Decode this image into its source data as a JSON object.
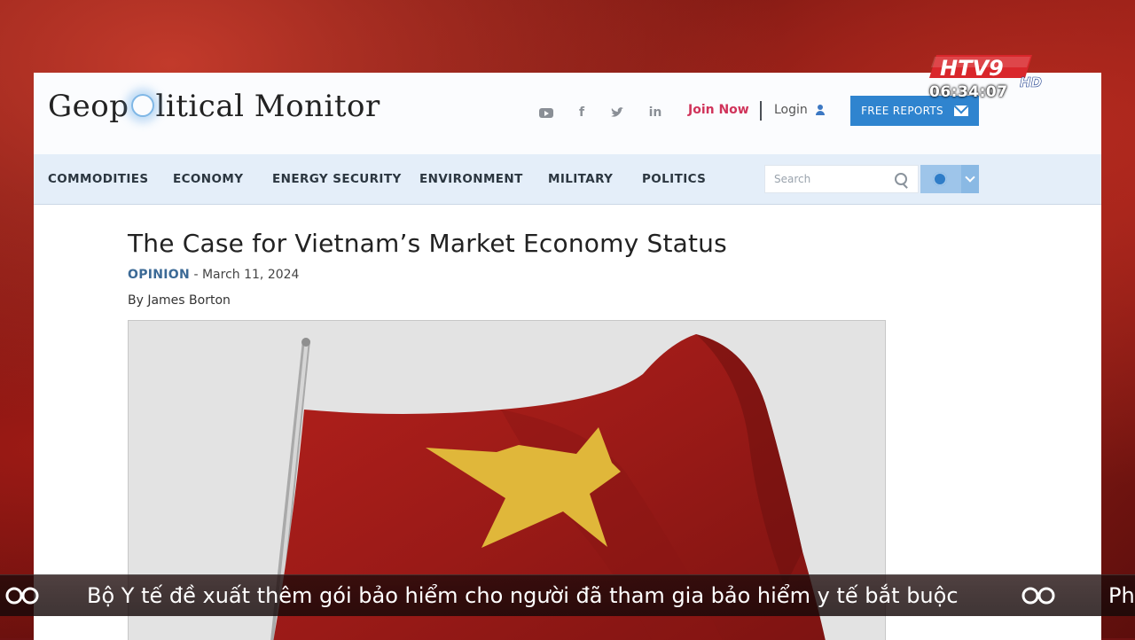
{
  "site": {
    "logo_left": "Geop",
    "logo_right": "litical Monitor",
    "social_icons": [
      "youtube-icon",
      "facebook-icon",
      "twitter-icon",
      "linkedin-icon"
    ],
    "facebook_glyph": "f",
    "linkedin_glyph": "in",
    "join_label": "Join Now",
    "login_label": "Login",
    "free_reports_label": "FREE REPORTS",
    "accent_color": "#2f84cf",
    "join_color": "#d0335a"
  },
  "nav": {
    "items": [
      "COMMODITIES",
      "ECONOMY",
      "ENERGY SECURITY",
      "ENVIRONMENT",
      "MILITARY",
      "POLITICS"
    ],
    "search_placeholder": "Search"
  },
  "article": {
    "title": "The Case for Vietnam’s Market Economy Status",
    "category": "OPINION",
    "date": "- March 11, 2024",
    "byline": "By James Borton"
  },
  "overlay": {
    "channel_text": "HTV9",
    "channel_hd": "HD",
    "clock": "06:34:07",
    "ticker": "Bộ Y tế đề xuất thêm gói bảo hiểm cho người đã tham gia bảo hiểm y tế bắt buộc",
    "ticker_next": "Ph"
  }
}
